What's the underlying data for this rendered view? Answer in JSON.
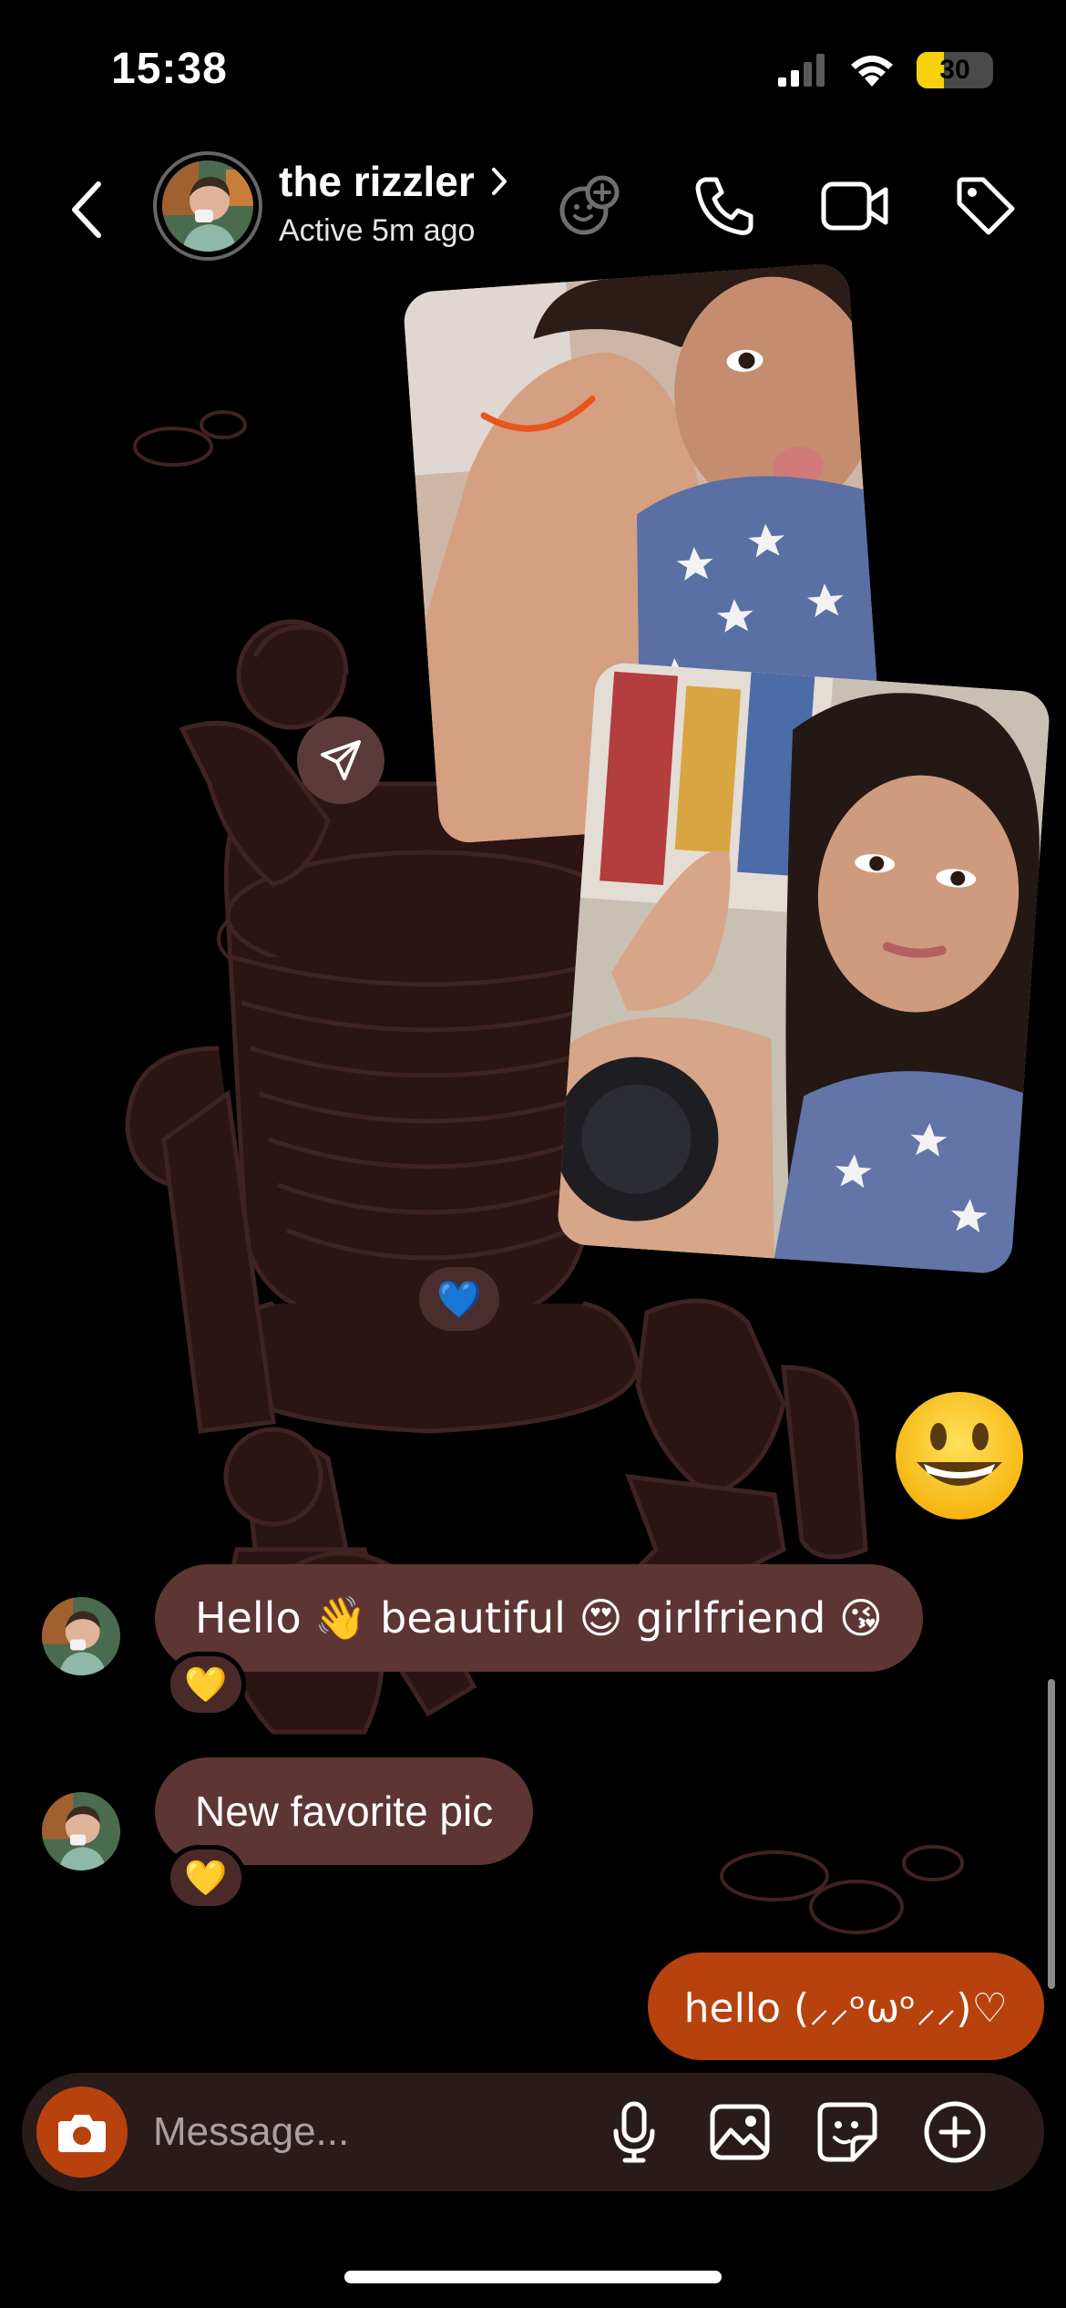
{
  "status_bar": {
    "time": "15:38",
    "battery_level": "30",
    "signal_icon": "cellular-signal-icon",
    "wifi_icon": "wifi-icon",
    "battery_icon": "battery-charging-icon"
  },
  "header": {
    "contact_name": "the rizzler",
    "active_status": "Active 5m ago",
    "icons": [
      "back-chevron-icon",
      "chevron-right-icon",
      "effects-face-plus-icon",
      "phone-icon",
      "video-camera-icon",
      "tag-icon"
    ]
  },
  "media": {
    "share_icon": "send-paper-plane-icon",
    "reaction": "💙"
  },
  "sticker_emoji": "😀",
  "messages": [
    {
      "direction": "incoming",
      "text": "Hello 👋 beautiful 😍 girlfriend 😘",
      "reaction": "💛"
    },
    {
      "direction": "incoming",
      "text": "New favorite pic",
      "reaction": "💛"
    },
    {
      "direction": "outgoing",
      "text": "hello (⸝⸝ᵒωᵒ⸝⸝)♡"
    }
  ],
  "composer": {
    "placeholder": "Message...",
    "icons": [
      "camera-icon",
      "microphone-icon",
      "gallery-icon",
      "sticker-icon",
      "plus-circle-icon"
    ]
  },
  "colors": {
    "incoming_bubble": "#5d3634",
    "outgoing_bubble": "#b7420d",
    "accent": "#b7420d",
    "background": "#000000",
    "battery_fill": "#f6d10c"
  }
}
